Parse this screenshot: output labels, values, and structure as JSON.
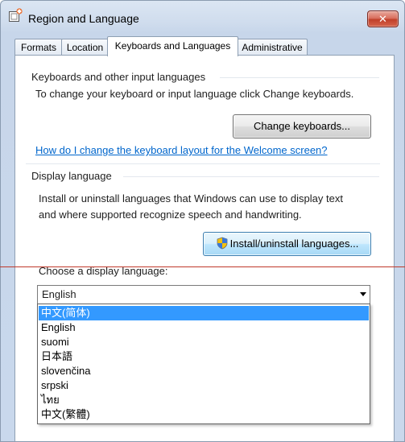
{
  "window": {
    "title": "Region and Language",
    "close_label": "✕"
  },
  "tabs": [
    {
      "label": "Formats"
    },
    {
      "label": "Location"
    },
    {
      "label": "Keyboards and Languages"
    },
    {
      "label": "Administrative"
    }
  ],
  "keyboards": {
    "heading": "Keyboards and other input languages",
    "description": "To change your keyboard or input language click Change keyboards.",
    "change_button": "Change keyboards...",
    "welcome_link": "How do I change the keyboard layout for the Welcome screen?"
  },
  "display": {
    "heading": "Display language",
    "description_line1": "Install or uninstall languages that Windows can use to display text",
    "description_line2": "and where supported recognize speech and handwriting.",
    "install_button": "Install/uninstall languages...",
    "choose_label": "Choose a display language:",
    "selected_value": "English",
    "options": [
      "中文(简体)",
      "English",
      "suomi",
      "日本語",
      "slovenčina",
      "srpski",
      "ไทย",
      "中文(繁體)"
    ],
    "highlighted_option": "中文(简体)"
  },
  "icons": {
    "app": "region-language-icon",
    "install": "uac-shield-icon",
    "dropdown": "chevron-down-icon"
  },
  "colors": {
    "link": "#0066cc",
    "selection": "#3399ff",
    "close_button": "#c0402a"
  }
}
